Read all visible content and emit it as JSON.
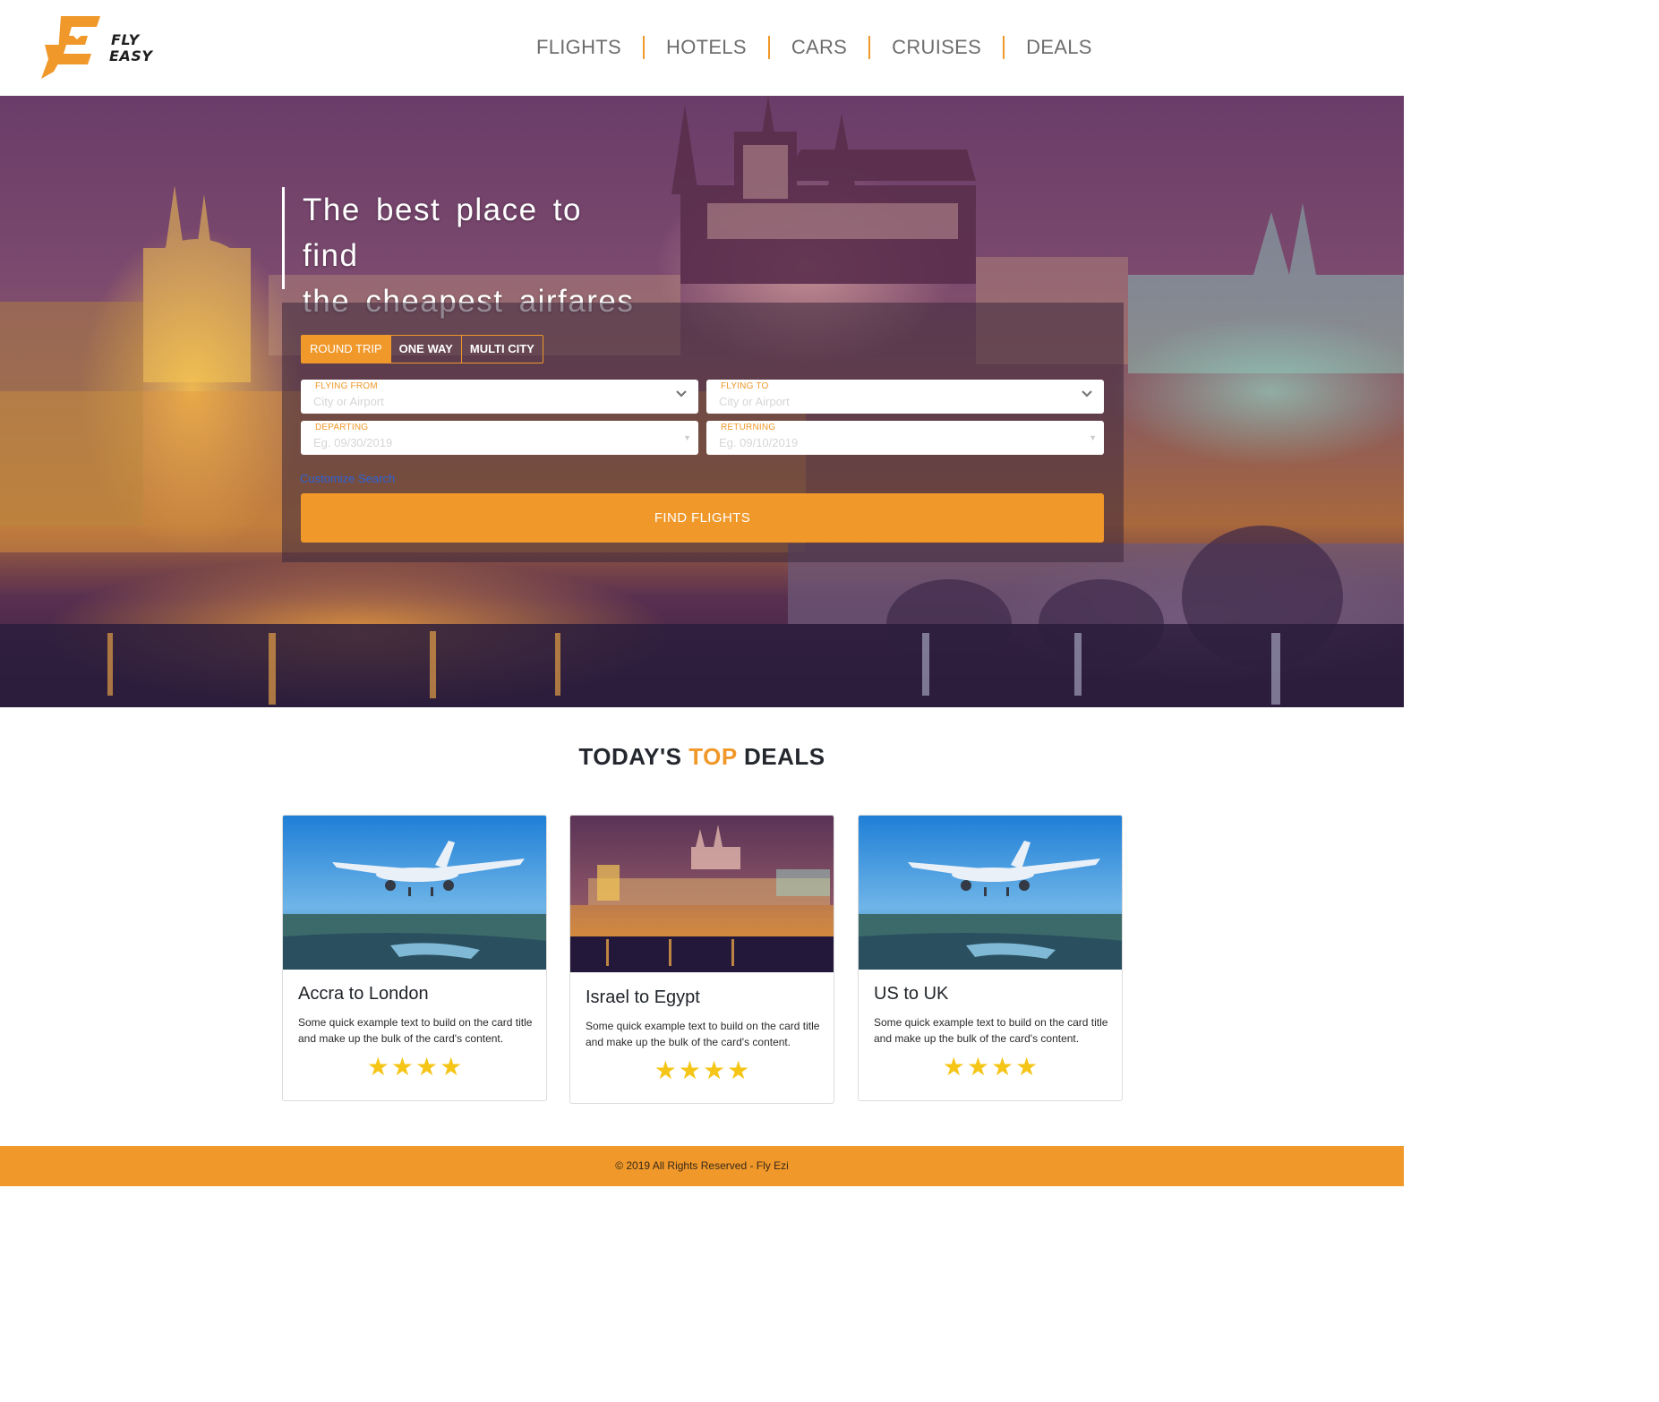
{
  "brand": {
    "name_line1": "FLY",
    "name_line2": "EASY",
    "accent_color": "#f0982a"
  },
  "nav": {
    "items": [
      {
        "label": "FLIGHTS"
      },
      {
        "label": "HOTELS"
      },
      {
        "label": "CARS"
      },
      {
        "label": "CRUISES"
      },
      {
        "label": "DEALS"
      }
    ]
  },
  "hero": {
    "headline_line1": "The best place to find",
    "headline_line2": "the cheapest airfares"
  },
  "search": {
    "trip_tabs": [
      {
        "label": "ROUND TRIP",
        "active": true
      },
      {
        "label": "ONE WAY",
        "active": false
      },
      {
        "label": "MULTI CITY",
        "active": false
      }
    ],
    "flying_from": {
      "label": "FLYING FROM",
      "placeholder": "City or Airport"
    },
    "flying_to": {
      "label": "FLYING TO",
      "placeholder": "City or Airport"
    },
    "departing": {
      "label": "DEPARTING",
      "placeholder": "Eg. 09/30/2019"
    },
    "returning": {
      "label": "RETURNING",
      "placeholder": "Eg. 09/10/2019"
    },
    "customize_label": "Customize Search",
    "submit_label": "FIND FLIGHTS"
  },
  "deals": {
    "title_part1": "TODAY'S ",
    "title_accent": "TOP",
    "title_part2": " DEALS",
    "cards": [
      {
        "title": "Accra to London",
        "text": "Some quick example text to build on the card title and make up the bulk of the card's content.",
        "rating": 4,
        "stars": "★★★★",
        "image": "airplane-over-city"
      },
      {
        "title": "Israel to Egypt",
        "text": "Some quick example text to build on the card title and make up the bulk of the card's content.",
        "rating": 4,
        "stars": "★★★★",
        "image": "castle-night-city"
      },
      {
        "title": "US to UK",
        "text": "Some quick example text to build on the card title and make up the bulk of the card's content.",
        "rating": 4,
        "stars": "★★★★",
        "image": "airplane-over-city"
      }
    ]
  },
  "footer": {
    "text": "© 2019 All Rights Reserved - Fly Ezi"
  }
}
